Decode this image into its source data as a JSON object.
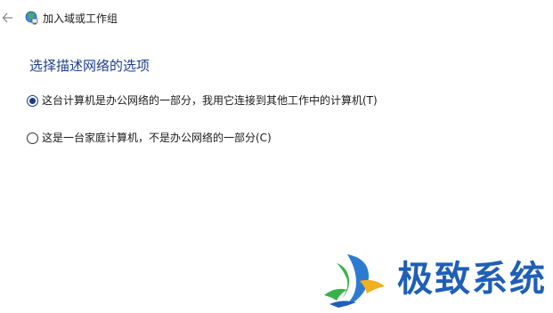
{
  "window": {
    "title": "加入域或工作组",
    "back_icon": "back-arrow-icon",
    "app_icon": "network-globe-icon"
  },
  "main": {
    "heading": "选择描述网络的选项",
    "options": [
      {
        "label": "这台计算机是办公网络的一部分，我用它连接到其他工作中的计算机(T)",
        "selected": true
      },
      {
        "label": "这是一台家庭计算机，不是办公网络的一部分(C)",
        "selected": false
      }
    ]
  },
  "watermark": {
    "text": "极致系统",
    "logo_icon": "dragon-logo-icon",
    "color": "#1f5fb8"
  },
  "colors": {
    "heading": "#1e3f8c",
    "radio_selected": "#1b3a8a"
  }
}
